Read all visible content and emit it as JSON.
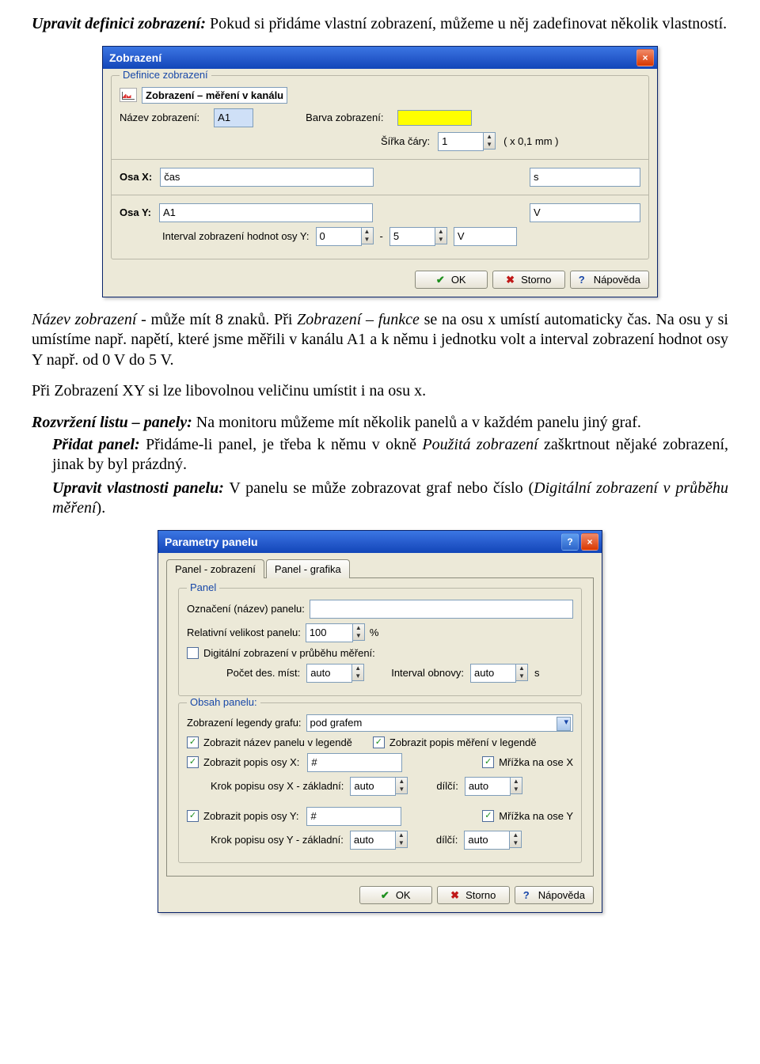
{
  "doc": {
    "p1a": "Upravit definici zobrazení:",
    "p1b": "  Pokud si přidáme vlastní zobrazení, můžeme u něj zadefinovat několik vlastností.",
    "p2a": "Název zobrazení - ",
    "p2b": "může mít 8 znaků. Při ",
    "p2c": "Zobrazení – funkce",
    "p2d": " se na osu x umístí automaticky čas. Na osu y si umístíme např. napětí, které jsme měřili v kanálu A1 a k němu i jednotku volt a interval zobrazení hodnot osy Y např. od 0 V do 5 V.",
    "p3": "Při Zobrazení XY si lze libovolnou veličinu umístit i na osu x.",
    "p4a": "Rozvržení listu – panely:",
    "p4b": " Na monitoru můžeme mít několik panelů a v každém panelu jiný graf.",
    "p5a": "Přidat panel:",
    "p5b": " Přidáme-li panel, je třeba k němu v okně ",
    "p5c": "Použitá zobrazení",
    "p5d": " zaškrtnout nějaké zobrazení, jinak by byl prázdný.",
    "p6a": "Upravit vlastnosti panelu:",
    "p6b": " V panelu se může zobrazovat graf nebo číslo (",
    "p6c": "Digitální zobrazení v průběhu měření",
    "p6d": ")."
  },
  "dlg1": {
    "title": "Zobrazení",
    "group": "Definice zobrazení",
    "chip": "Zobrazení – měření v kanálu",
    "name_label": "Název zobrazení:",
    "name_value": "A1",
    "color_label": "Barva zobrazení:",
    "width_label": "Šířka čáry:",
    "width_value": "1",
    "width_suffix": "( x 0,1 mm )",
    "axisX_label": "Osa X:",
    "axisX_value": "čas",
    "axisX_unit": "s",
    "axisY_label": "Osa Y:",
    "axisY_value": "A1",
    "axisY_unit": "V",
    "interval_label": "Interval zobrazení hodnot osy Y:",
    "interval_from": "0",
    "interval_dash": "-",
    "interval_to": "5",
    "interval_unit": "V",
    "ok": "OK",
    "cancel": "Storno",
    "help": "Nápověda"
  },
  "dlg2": {
    "title": "Parametry panelu",
    "tab1": "Panel - zobrazení",
    "tab2": "Panel - grafika",
    "group_panel": "Panel",
    "panel_name_label": "Označení (název) panelu:",
    "panel_name_value": "",
    "relsize_label": "Relativní velikost panelu:",
    "relsize_value": "100",
    "relsize_unit": "%",
    "digital_label": "Digitální zobrazení v průběhu měření:",
    "decplaces_label": "Počet des. míst:",
    "decplaces_value": "auto",
    "refresh_label": "Interval obnovy:",
    "refresh_value": "auto",
    "refresh_unit": "s",
    "group_content": "Obsah panelu:",
    "legend_label": "Zobrazení legendy grafu:",
    "legend_value": "pod grafem",
    "chk_panel_name": "Zobrazit název panelu v legendě",
    "chk_meas_desc": "Zobrazit popis měření v legendě",
    "chk_axisx": "Zobrazit popis osy X:",
    "axisx_value": "#",
    "chk_gridx": "Mřížka na ose X",
    "stepx_label": "Krok popisu osy X - základní:",
    "stepx_value": "auto",
    "stepx_small_label": "dílčí:",
    "stepx_small_value": "auto",
    "chk_axisy": "Zobrazit popis osy Y:",
    "axisy_value": "#",
    "chk_gridy": "Mřížka na ose Y",
    "stepy_label": "Krok popisu osy Y - základní:",
    "stepy_value": "auto",
    "stepy_small_label": "dílčí:",
    "stepy_small_value": "auto",
    "ok": "OK",
    "cancel": "Storno",
    "help": "Nápověda"
  }
}
